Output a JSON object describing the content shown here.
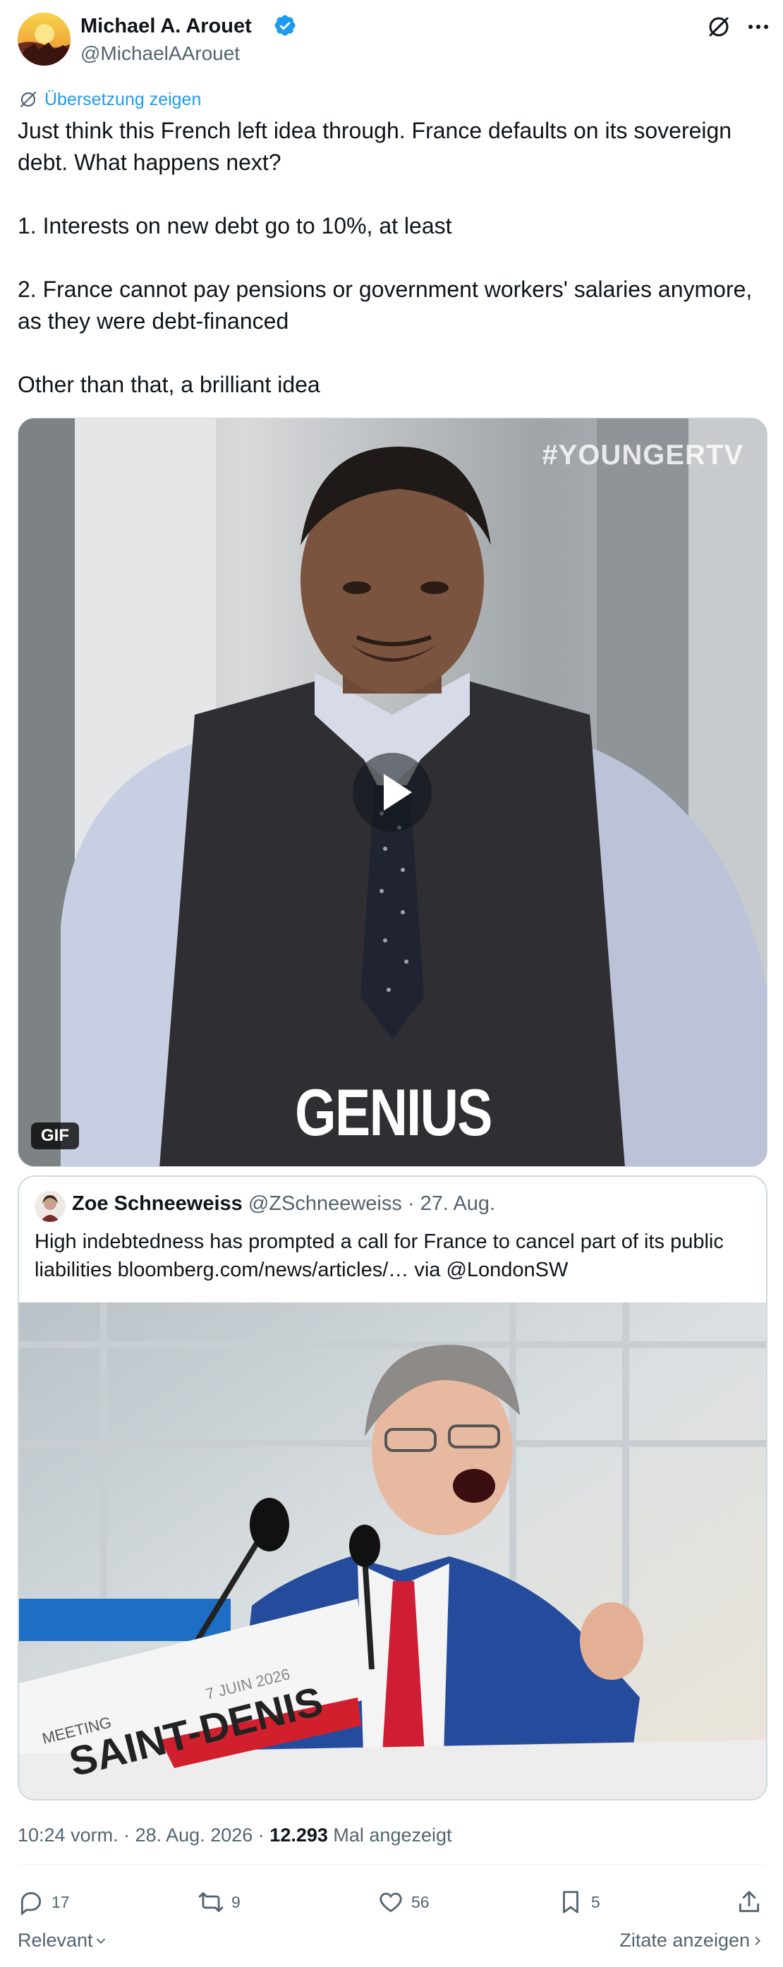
{
  "author": {
    "name": "Michael A. Arouet",
    "handle": "@MichaelAArouet",
    "verified": true
  },
  "translate_label": "Übersetzung zeigen",
  "tweet": {
    "lines": [
      "Just think this French left idea through. France defaults on its sovereign",
      "debt. What happens next?",
      "1. Interests on new debt go to 10%, at least",
      "2. France cannot pay pensions or government workers' salaries anymore,",
      "as they were debt-financed",
      "Other than that, a brilliant idea"
    ]
  },
  "gif": {
    "watermark": "#YOUNGERTV",
    "caption": "GENIUS",
    "badge": "GIF"
  },
  "quote": {
    "name": "Zoe Schneeweiss",
    "handle": "@ZSchneeweiss",
    "separator": "·",
    "date": "27. Aug.",
    "text_line1": "High indebtedness has prompted a call for France to cancel part of its public",
    "text_line2": "liabilities bloomberg.com/news/articles/… via @LondonSW",
    "image": {
      "podium_small": "MEETING",
      "podium_big": "SAINT-DENIS",
      "podium_date": "7 JUIN 2026"
    }
  },
  "meta": {
    "time": "10:24 vorm.",
    "sep": "·",
    "date": "28. Aug. 2026",
    "views": "12.293",
    "views_label": "Mal angezeigt"
  },
  "actions": {
    "replies": "17",
    "reposts": "9",
    "likes": "56",
    "bookmarks": "5"
  },
  "footer": {
    "sort_label": "Relevant",
    "quotes_label": "Zitate anzeigen"
  },
  "colors": {
    "accent": "#1d9bf0",
    "secondary_text": "#536471",
    "primary_text": "#0f1419"
  }
}
